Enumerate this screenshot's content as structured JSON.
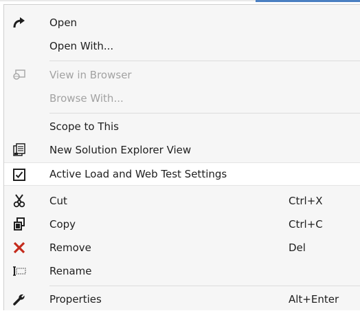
{
  "context_menu": {
    "items": [
      {
        "label": "Open",
        "shortcut": "",
        "icon": "redo-arrow-icon",
        "enabled": true
      },
      {
        "label": "Open With...",
        "shortcut": "",
        "icon": "",
        "enabled": true
      },
      {
        "label": "View in Browser",
        "shortcut": "",
        "icon": "view-in-browser-icon",
        "enabled": false
      },
      {
        "label": "Browse With...",
        "shortcut": "",
        "icon": "",
        "enabled": false
      },
      {
        "label": "Scope to This",
        "shortcut": "",
        "icon": "",
        "enabled": true
      },
      {
        "label": "New Solution Explorer View",
        "shortcut": "",
        "icon": "new-solution-explorer-view-icon",
        "enabled": true
      },
      {
        "label": "Active Load and Web Test Settings",
        "shortcut": "",
        "icon": "checkbox-checked-icon",
        "enabled": true,
        "checked": true
      },
      {
        "label": "Cut",
        "shortcut": "Ctrl+X",
        "icon": "scissors-icon",
        "enabled": true
      },
      {
        "label": "Copy",
        "shortcut": "Ctrl+C",
        "icon": "copy-icon",
        "enabled": true
      },
      {
        "label": "Remove",
        "shortcut": "Del",
        "icon": "remove-x-icon",
        "enabled": true
      },
      {
        "label": "Rename",
        "shortcut": "",
        "icon": "rename-icon",
        "enabled": true
      },
      {
        "label": "Properties",
        "shortcut": "Alt+Enter",
        "icon": "wrench-icon",
        "enabled": true
      }
    ]
  },
  "colors": {
    "menu_background": "#f6f6f6",
    "highlight_background": "#ffffff",
    "text": "#1e1e1e",
    "disabled_text": "#a2a2a2",
    "remove_icon_red": "#c42b1c",
    "accent": "#4a7fc1"
  }
}
